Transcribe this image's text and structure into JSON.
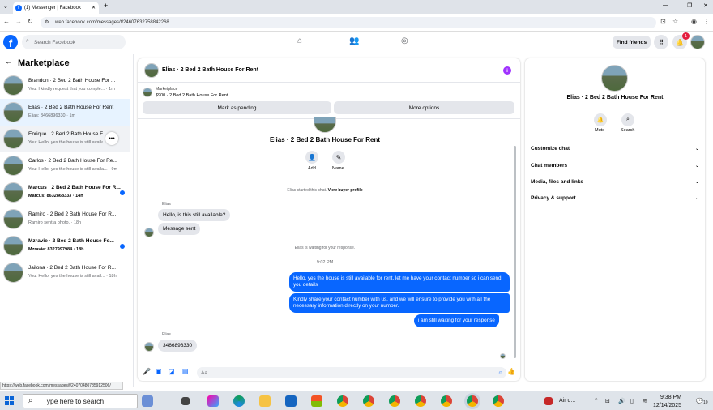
{
  "browser": {
    "tab_title": "(1) Messenger | Facebook",
    "url": "web.facebook.com/messages/t/24607632758842268",
    "status_url": "https://web.facebook.com/messages/t/24070480785912506/"
  },
  "fbbar": {
    "logo": "f",
    "search_placeholder": "Search Facebook",
    "find_friends": "Find friends",
    "notif_count": "1"
  },
  "sidebar": {
    "title": "Marketplace",
    "conversations": [
      {
        "title": "Brandon · 2 Bed 2 Bath House For ...",
        "snippet": "You: I kindly request that you comple... · 1m",
        "unread": false
      },
      {
        "title": "Elias · 2 Bed 2 Bath House For Rent",
        "snippet": "Elias: 3466896330 · 1m",
        "unread": false
      },
      {
        "title": "Enrique · 2 Bed 2 Bath House For R...",
        "snippet": "You: Hello, yes the house is still availa... · ",
        "unread": false
      },
      {
        "title": "Carlos · 2 Bed 2 Bath House For Re...",
        "snippet": "You: Hello, yes the house is still availa... · 9m",
        "unread": false
      },
      {
        "title": "Marcus · 2 Bed 2 Bath House For R...",
        "snippet": "Marcus: 8632868333 · 14h",
        "unread": true
      },
      {
        "title": "Ramiro · 2 Bed 2 Bath House For R...",
        "snippet": "Ramiro sent a photo. · 18h",
        "unread": false
      },
      {
        "title": "Mzravie · 2 Bed 2 Bath House Fo...",
        "snippet": "Mzravie: 8327997984 · 18h",
        "unread": true
      },
      {
        "title": "Jailona · 2 Bed 2 Bath House For R...",
        "snippet": "You: Hello, yes the house is still avail... · 18h",
        "unread": false
      }
    ]
  },
  "chat": {
    "header_name": "Elias · 2 Bed 2 Bath House For Rent",
    "marketplace_label": "Marketplace",
    "listing": "$900 · 2 Bed 2 Bath House For Rent",
    "mark_pending": "Mark as pending",
    "more_options": "More options",
    "contact_name": "Elias · 2 Bed 2 Bath House For Rent",
    "add_label": "Add",
    "names_label": "Name",
    "started_prefix": "Elias started this chat.",
    "view_profile": "View buyer profile",
    "sender1": "Elias",
    "msg1": "Hello, is this still available?",
    "msg2": "Message sent",
    "waiting": "Elias is waiting for your response.",
    "time": "9:02 PM",
    "out1": "Hello, yes the house is still available for rent, let me have your contact number so i can send you  details",
    "out2": "Kindly share your contact number with us, and we will ensure to provide you with all the necessary information directly on your number.",
    "out3": "i am still waiting for your response",
    "sender2": "Elias",
    "msg3": "3466896330",
    "composer_placeholder": "Aa"
  },
  "right_panel": {
    "name": "Elias · 2 Bed 2 Bath House For Rent",
    "mute": "Mute",
    "search": "Search",
    "sections": [
      "Customize chat",
      "Chat members",
      "Media, files and links",
      "Privacy & support"
    ]
  },
  "taskbar": {
    "search_placeholder": "Type here to search",
    "weather": "Air q...",
    "time": "9:38 PM",
    "date": "12/14/2025",
    "notif": "10"
  }
}
